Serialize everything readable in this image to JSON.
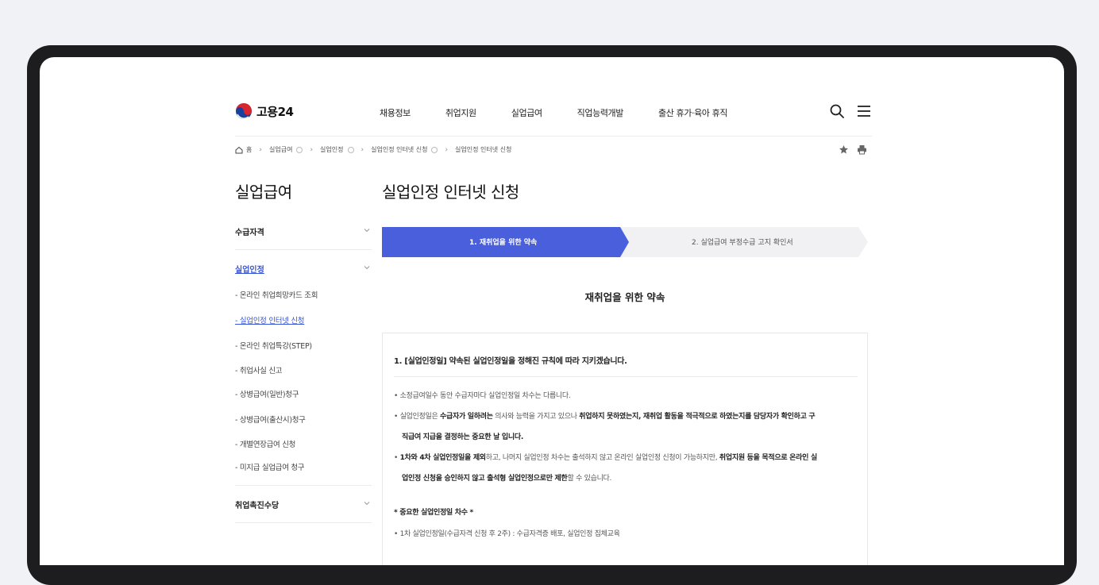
{
  "logo": {
    "text": "고용24"
  },
  "nav": [
    "채용정보",
    "취업지원",
    "실업급여",
    "직업능력개발",
    "출산 휴가·육아 휴직"
  ],
  "breadcrumb": {
    "home": "홈",
    "items": [
      "실업급여",
      "실업인정",
      "실업인정 인터넷 신청",
      "실업인정 인터넷 신청"
    ]
  },
  "sidebar": {
    "title": "실업급여",
    "sections": [
      {
        "label": "수급자격"
      },
      {
        "label": "실업인정",
        "items": [
          "- 온라인 취업희망카드 조회",
          "- 실업인정 인터넷 신청",
          "- 온라인 취업특강(STEP)",
          "- 취업사실 신고",
          "- 상병급여(일반)청구",
          "- 상병급여(출산시)청구",
          "- 개별연장급여 신청",
          "- 미지급 실업급여 청구"
        ]
      },
      {
        "label": "취업촉진수당"
      }
    ]
  },
  "main": {
    "title": "실업인정 인터넷 신청",
    "steps": [
      "1. 재취업을 위한 약속",
      "2. 실업급여 부정수급 고지 확인서"
    ],
    "pledge_title": "재취업을 위한 약속",
    "box": {
      "heading": "1. [실업인정일] 약속된 실업인정일을 정해진 규칙에 따라 지키겠습니다.",
      "line1": "소정급여일수 동안 수급자마다 실업인정일 차수는 다릅니다.",
      "line2_a": "실업인정일은 ",
      "line2_b": "수급자가 일하려는",
      "line2_c": " 의사와 능력을 가지고 있으나 ",
      "line2_d": "취업하지 못하였는지, 재취업 활동을 적극적으로 하였는지를 담당자가 확인하고 구",
      "line2_cont": "직급여 지급을 결정하는 중요한 날 입니다.",
      "line3_a": "1차와 4차 실업인정일을 제외",
      "line3_b": "하고, 나머지 실업인정 차수는 출석하지 않고 온라인 실업인정 신청이 가능하지만, ",
      "line3_c": "취업지원 등을 목적으로 온라인 실",
      "line3_cont_a": "업인정 신청을 승인하지 않고 출석형 실업인정으로만 제한",
      "line3_cont_b": "할 수 있습니다.",
      "important": "* 중요한 실업인정일 차수 *",
      "line4": "1차 실업인정일(수급자격 신청 후 2주) : 수급자격증 배포, 실업인정 집체교육"
    }
  },
  "colors": {
    "accent": "#4a5fdc",
    "active_link": "#3755d8"
  }
}
